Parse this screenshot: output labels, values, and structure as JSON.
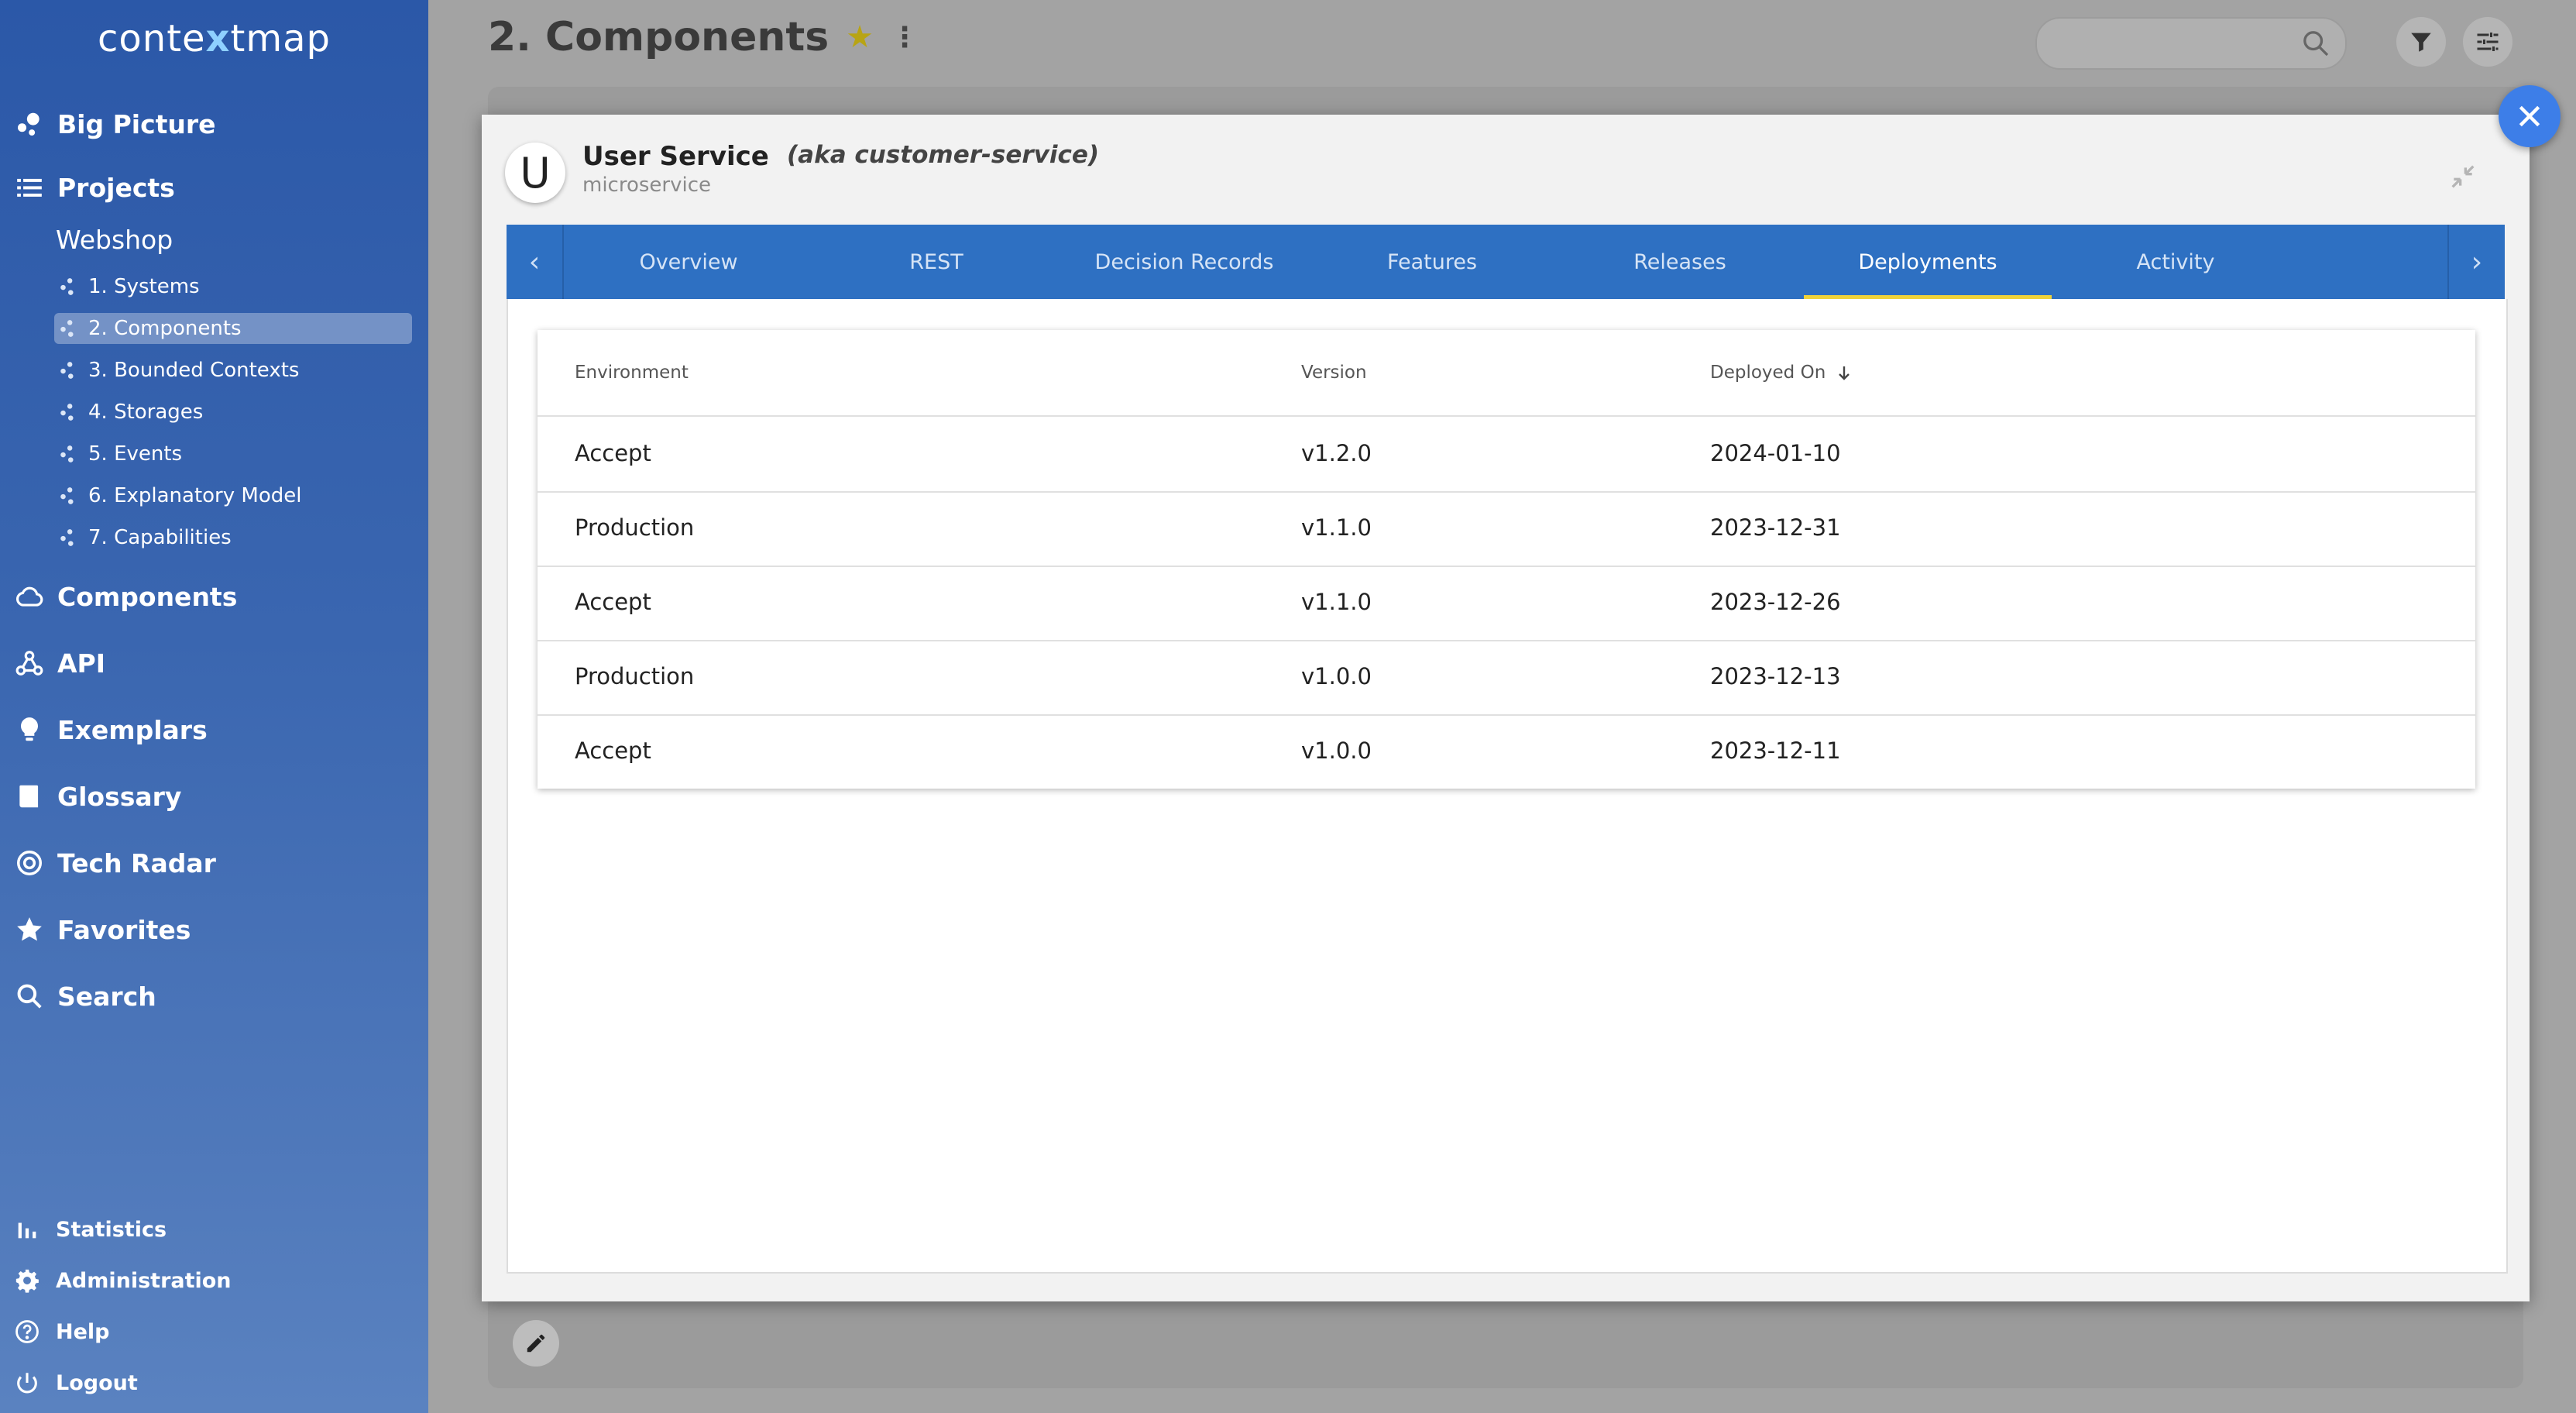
{
  "app": {
    "logo_pre": "conte",
    "logo_x": "x",
    "logo_post": "tmap"
  },
  "sidebar": {
    "big_picture": "Big Picture",
    "projects": "Projects",
    "project_name": "Webshop",
    "sub_items": [
      {
        "label": "1. Systems",
        "active": false
      },
      {
        "label": "2. Components",
        "active": true
      },
      {
        "label": "3. Bounded Contexts",
        "active": false
      },
      {
        "label": "4. Storages",
        "active": false
      },
      {
        "label": "5. Events",
        "active": false
      },
      {
        "label": "6. Explanatory Model",
        "active": false
      },
      {
        "label": "7. Capabilities",
        "active": false
      }
    ],
    "nav": [
      {
        "label": "Components",
        "icon": "cloud-icon"
      },
      {
        "label": "API",
        "icon": "webhook-icon"
      },
      {
        "label": "Exemplars",
        "icon": "lightbulb-icon"
      },
      {
        "label": "Glossary",
        "icon": "book-icon"
      },
      {
        "label": "Tech Radar",
        "icon": "radar-icon"
      },
      {
        "label": "Favorites",
        "icon": "star-icon"
      },
      {
        "label": "Search",
        "icon": "search-icon"
      }
    ],
    "bottom": [
      {
        "label": "Statistics",
        "icon": "bar-chart-icon"
      },
      {
        "label": "Administration",
        "icon": "gear-icon"
      },
      {
        "label": "Help",
        "icon": "help-icon"
      },
      {
        "label": "Logout",
        "icon": "power-icon"
      }
    ]
  },
  "header": {
    "title": "2. Components",
    "search_placeholder": ""
  },
  "modal": {
    "avatar_letter": "U",
    "service_name": "User Service",
    "service_type": "microservice",
    "aka": "(aka customer-service)",
    "tabs": [
      {
        "label": "Overview",
        "active": false
      },
      {
        "label": "REST",
        "active": false
      },
      {
        "label": "Decision Records",
        "active": false
      },
      {
        "label": "Features",
        "active": false
      },
      {
        "label": "Releases",
        "active": false
      },
      {
        "label": "Deployments",
        "active": true
      },
      {
        "label": "Activity",
        "active": false
      }
    ],
    "table": {
      "headers": {
        "environment": "Environment",
        "version": "Version",
        "deployed_on": "Deployed On"
      },
      "sort": "descending",
      "rows": [
        {
          "environment": "Accept",
          "version": "v1.2.0",
          "deployed_on": "2024-01-10"
        },
        {
          "environment": "Production",
          "version": "v1.1.0",
          "deployed_on": "2023-12-31"
        },
        {
          "environment": "Accept",
          "version": "v1.1.0",
          "deployed_on": "2023-12-26"
        },
        {
          "environment": "Production",
          "version": "v1.0.0",
          "deployed_on": "2023-12-13"
        },
        {
          "environment": "Accept",
          "version": "v1.0.0",
          "deployed_on": "2023-12-11"
        }
      ]
    }
  },
  "colors": {
    "sidebar_top": "#2b58a8",
    "tab_bar": "#2e70c2",
    "tab_indicator": "#f0d33a",
    "close_button": "#3d7ee8",
    "favorite_star": "#b8a414"
  }
}
